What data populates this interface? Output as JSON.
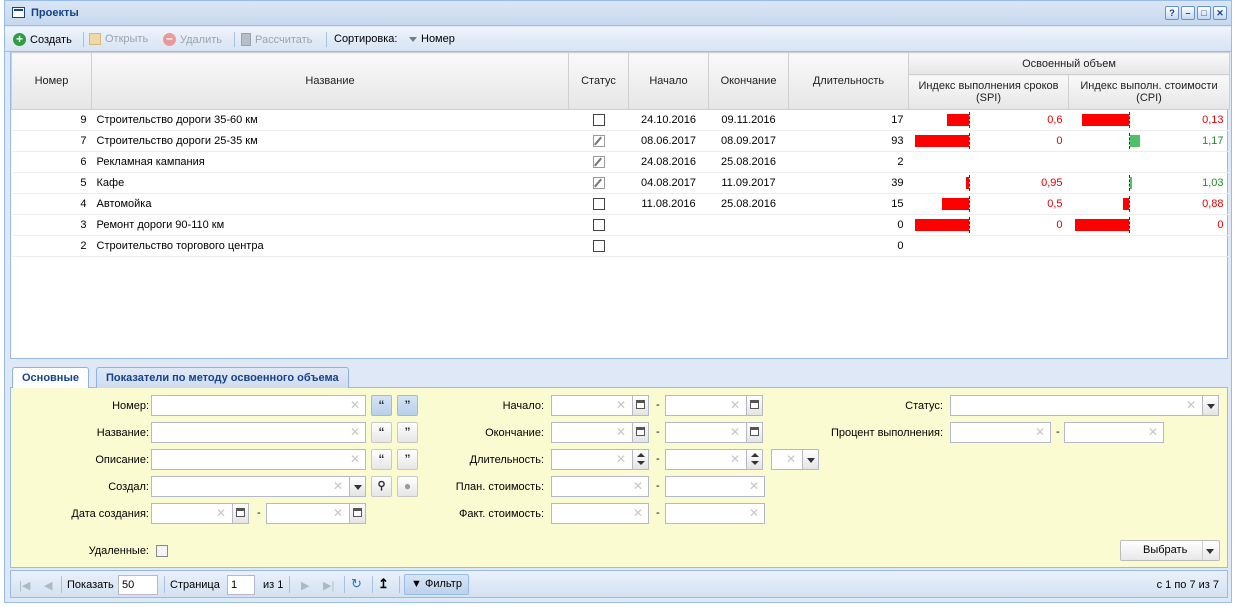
{
  "window": {
    "title": "Проекты",
    "controls": [
      "?",
      "–",
      "□",
      "✕"
    ]
  },
  "toolbar": {
    "create": "Создать",
    "open": "Открыть",
    "delete": "Удалить",
    "calc": "Рассчитать",
    "sort_label": "Сортировка:",
    "sort_value": "Номер"
  },
  "grid": {
    "headers": {
      "number": "Номер",
      "name": "Название",
      "status": "Статус",
      "start": "Начало",
      "end": "Окончание",
      "duration": "Длительность",
      "earned_value": "Освоенный объем",
      "spi": "Индекс выполнения сроков (SPI)",
      "cpi": "Индекс выполн. стоимости (CPI)"
    },
    "rows": [
      {
        "num": "9",
        "name": "Строительство дороги 35-60 км",
        "status": "checkbox",
        "start": "24.10.2016",
        "end": "09.11.2016",
        "duration": "17",
        "spi": 0.6,
        "spi_label": "0,6",
        "cpi": 0.13,
        "cpi_label": "0,13"
      },
      {
        "num": "7",
        "name": "Строительство дороги 25-35 км",
        "status": "edit",
        "start": "08.06.2017",
        "end": "08.09.2017",
        "duration": "93",
        "spi": 0,
        "spi_label": "0",
        "cpi": 1.17,
        "cpi_label": "1,17"
      },
      {
        "num": "6",
        "name": "Рекламная кампания",
        "status": "edit",
        "start": "24.08.2016",
        "end": "25.08.2016",
        "duration": "2",
        "spi": null,
        "spi_label": "",
        "cpi": null,
        "cpi_label": ""
      },
      {
        "num": "5",
        "name": "Кафе",
        "status": "edit",
        "start": "04.08.2017",
        "end": "11.09.2017",
        "duration": "39",
        "spi": 0.95,
        "spi_label": "0,95",
        "cpi": 1.03,
        "cpi_label": "1,03"
      },
      {
        "num": "4",
        "name": "Автомойка",
        "status": "checkbox",
        "start": "11.08.2016",
        "end": "25.08.2016",
        "duration": "15",
        "spi": 0.5,
        "spi_label": "0,5",
        "cpi": 0.88,
        "cpi_label": "0,88"
      },
      {
        "num": "3",
        "name": "Ремонт дороги 90-110 км",
        "status": "checkbox",
        "start": "",
        "end": "",
        "duration": "0",
        "spi": 0,
        "spi_label": "0",
        "cpi": 0,
        "cpi_label": "0"
      },
      {
        "num": "2",
        "name": "Строительство торгового центра",
        "status": "checkbox",
        "start": "",
        "end": "",
        "duration": "0",
        "spi": null,
        "spi_label": "",
        "cpi": null,
        "cpi_label": ""
      }
    ]
  },
  "tabs": {
    "main": "Основные",
    "earned": "Показатели по методу освоенного объема"
  },
  "filter": {
    "number": "Номер:",
    "name": "Название:",
    "description": "Описание:",
    "created_by": "Создал:",
    "created_date": "Дата создания:",
    "start": "Начало:",
    "end": "Окончание:",
    "duration": "Длительность:",
    "plan_cost": "План. стоимость:",
    "fact_cost": "Факт. стоимость:",
    "status": "Статус:",
    "percent": "Процент выполнения:",
    "deleted": "Удаленные:",
    "select": "Выбрать",
    "quote_open": "“",
    "quote_close": "”",
    "dash": "-",
    "clear": "✕"
  },
  "pager": {
    "show": "Показать",
    "page_size": "50",
    "page": "Страница",
    "page_value": "1",
    "of": "из 1",
    "filter": "Фильтр",
    "summary": "с 1 по 7 из 7"
  },
  "colors": {
    "negative": "#ff0000",
    "positive": "#4fbf6a",
    "accent": "#15428b",
    "filter_bg": "#fbfbd1"
  }
}
